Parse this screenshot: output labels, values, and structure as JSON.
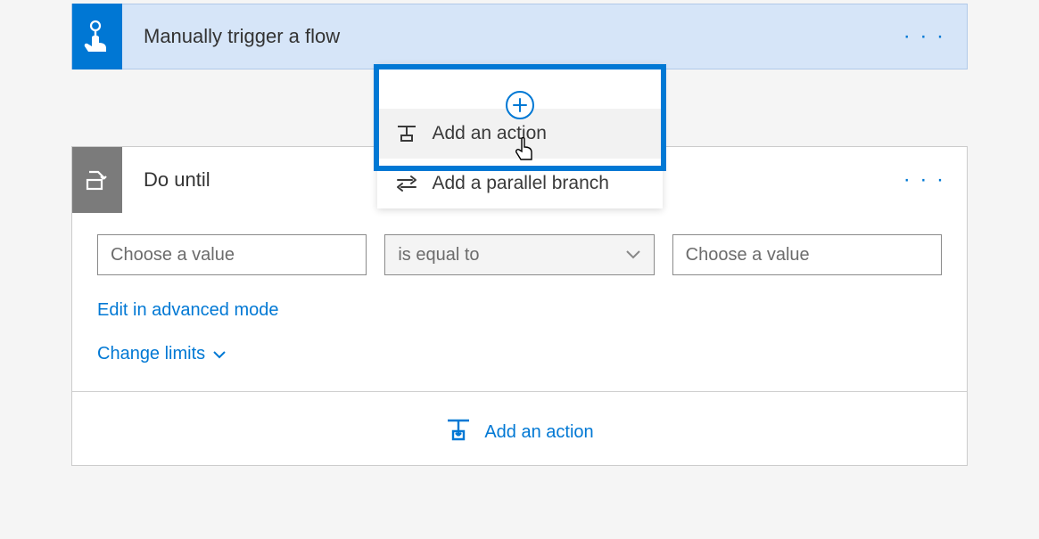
{
  "trigger": {
    "title": "Manually trigger a flow"
  },
  "insert_menu": {
    "add_action": "Add an action",
    "add_parallel": "Add a parallel branch"
  },
  "do_until": {
    "title": "Do until",
    "left_placeholder": "Choose a value",
    "operator": "is equal to",
    "right_placeholder": "Choose a value",
    "edit_advanced": "Edit in advanced mode",
    "change_limits": "Change limits",
    "add_action": "Add an action"
  }
}
